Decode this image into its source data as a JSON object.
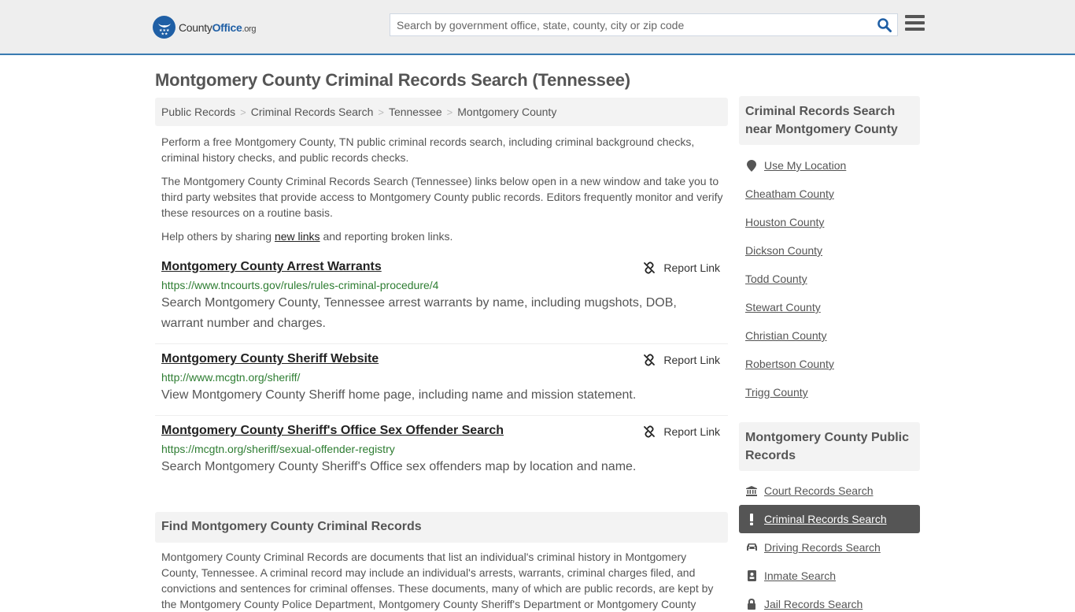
{
  "header": {
    "logo": {
      "brand_part1": "County",
      "brand_part2": "Office",
      "brand_suffix": ".org",
      "icon": "eagle-stars-badge-icon"
    },
    "search": {
      "placeholder": "Search by government office, state, county, city or zip code",
      "value": "",
      "button_icon": "search-icon"
    },
    "menu_icon": "hamburger-menu-icon"
  },
  "colors": {
    "brand": "#1f5fa5",
    "url_green": "#2e7d32",
    "active_bg": "#555555",
    "panel_bg": "#f3f3f3",
    "header_border": "#3a7bb0"
  },
  "page": {
    "title": "Montgomery County Criminal Records Search (Tennessee)",
    "breadcrumb": [
      "Public Records",
      "Criminal Records Search",
      "Tennessee",
      "Montgomery County"
    ],
    "breadcrumb_separator": ">",
    "intro": {
      "p1": "Perform a free Montgomery County, TN public criminal records search, including criminal background checks, criminal history checks, and public records checks.",
      "p2": "The Montgomery County Criminal Records Search (Tennessee) links below open in a new window and take you to third party websites that provide access to Montgomery County public records. Editors frequently monitor and verify these resources on a routine basis.",
      "p3_before": "Help others by sharing ",
      "p3_link": "new links",
      "p3_after": " and reporting broken links."
    },
    "results": [
      {
        "title": "Montgomery County Arrest Warrants",
        "url": "https://www.tncourts.gov/rules/rules-criminal-procedure/4",
        "description": "Search Montgomery County, Tennessee arrest warrants by name, including mugshots, DOB, warrant number and charges.",
        "report_label": "Report Link"
      },
      {
        "title": "Montgomery County Sheriff Website",
        "url": "http://www.mcgtn.org/sheriff/",
        "description": "View Montgomery County Sheriff home page, including name and mission statement.",
        "report_label": "Report Link"
      },
      {
        "title": "Montgomery County Sheriff's Office Sex Offender Search",
        "url": "https://mcgtn.org/sheriff/sexual-offender-registry",
        "description": "Search Montgomery County Sheriff's Office sex offenders map by location and name.",
        "report_label": "Report Link"
      }
    ],
    "find_section": {
      "heading": "Find Montgomery County Criminal Records",
      "body": "Montgomery County Criminal Records are documents that list an individual's criminal history in Montgomery County, Tennessee. A criminal record may include an individual's arrests, warrants, criminal charges filed, and convictions and sentences for criminal offenses. These documents, many of which are public records, are kept by the Montgomery County Police Department, Montgomery County Sheriff's Department or Montgomery County"
    }
  },
  "sidebar": {
    "nearby": {
      "heading": "Criminal Records Search near Montgomery County",
      "use_location": "Use My Location",
      "counties": [
        "Cheatham County",
        "Houston County",
        "Dickson County",
        "Todd County",
        "Stewart County",
        "Christian County",
        "Robertson County",
        "Trigg County"
      ]
    },
    "public_records": {
      "heading": "Montgomery County Public Records",
      "items": [
        {
          "label": "Court Records Search",
          "icon": "courthouse-icon",
          "active": false
        },
        {
          "label": "Criminal Records Search",
          "icon": "exclamation-icon",
          "active": true
        },
        {
          "label": "Driving Records Search",
          "icon": "car-icon",
          "active": false
        },
        {
          "label": "Inmate Search",
          "icon": "id-badge-icon",
          "active": false
        },
        {
          "label": "Jail Records Search",
          "icon": "lock-icon",
          "active": false
        }
      ]
    }
  }
}
